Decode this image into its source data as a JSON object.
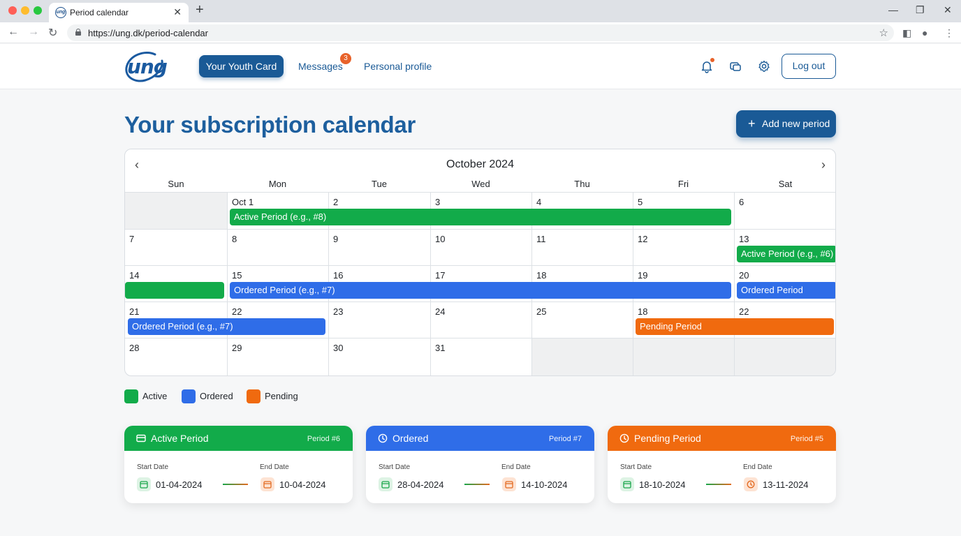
{
  "browser": {
    "tab_title": "Period calendar",
    "url": "https://ung.dk/period-calendar"
  },
  "header": {
    "logo_text": "ung",
    "nav": {
      "youth_card": "Your Youth Card",
      "messages": "Messages",
      "messages_badge": "3",
      "profile": "Personal profile"
    },
    "logout": "Log out"
  },
  "page": {
    "title": "Your subscription calendar",
    "add_button": "Add new period"
  },
  "calendar": {
    "month": "October 2024",
    "weekdays": [
      "Sun",
      "Mon",
      "Tue",
      "Wed",
      "Thu",
      "Fri",
      "Sat"
    ],
    "weeks": [
      [
        "",
        "Oct 1",
        "2",
        "3",
        "4",
        "5",
        "6"
      ],
      [
        "7",
        "8",
        "9",
        "10",
        "11",
        "12",
        "13"
      ],
      [
        "14",
        "15",
        "16",
        "17",
        "18",
        "19",
        "20"
      ],
      [
        "21",
        "22",
        "23",
        "24",
        "25",
        "18",
        "22"
      ],
      [
        "28",
        "29",
        "30",
        "31",
        "",
        "",
        ""
      ]
    ],
    "events": [
      {
        "label": "Active Period (e.g., #8)",
        "status": "active"
      },
      {
        "label": "Active Period (e.g., #6)",
        "status": "active"
      },
      {
        "label": "",
        "status": "active"
      },
      {
        "label": "Ordered Period (e.g., #7)",
        "status": "ordered"
      },
      {
        "label": "Ordered Period",
        "status": "ordered"
      },
      {
        "label": "Ordered Period (e.g., #7)",
        "status": "ordered"
      },
      {
        "label": "Pending Period",
        "status": "pending"
      }
    ]
  },
  "legend": [
    {
      "label": "Active",
      "color": "#12ab4a"
    },
    {
      "label": "Ordered",
      "color": "#2f6de8"
    },
    {
      "label": "Pending",
      "color": "#f06a0f"
    }
  ],
  "cards": [
    {
      "title": "Active Period",
      "id": "Period #6",
      "color": "#12ab4a",
      "icon": "card-icon",
      "start_label": "Start Date",
      "start": "01-04-2024",
      "end_label": "End Date",
      "end": "10-04-2024"
    },
    {
      "title": "Ordered",
      "id": "Period #7",
      "color": "#2f6de8",
      "icon": "clock-icon",
      "start_label": "Start Date",
      "start": "28-04-2024",
      "end_label": "End Date",
      "end": "14-10-2024"
    },
    {
      "title": "Pending Period",
      "id": "Period #5",
      "color": "#f06a0f",
      "icon": "clock-icon",
      "start_label": "Start Date",
      "start": "18-10-2024",
      "end_label": "End Date",
      "end": "13-11-2024"
    }
  ]
}
